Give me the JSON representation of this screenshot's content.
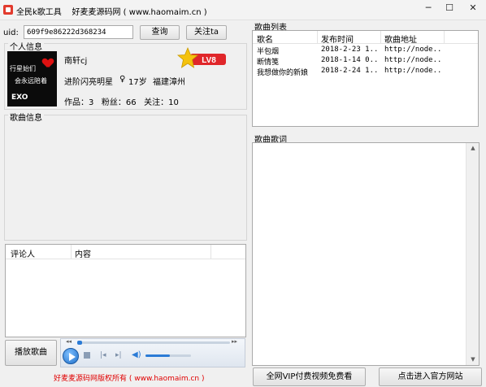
{
  "window": {
    "title": "全民k歌工具    好麦麦源码网 ( www.haomaim.cn )",
    "minimize": "─",
    "maximize": "☐",
    "close": "✕"
  },
  "top": {
    "uid_label": "uid:",
    "uid_value": "609f9e86222d368234",
    "query_button": "查询",
    "follow_button": "关注ta"
  },
  "profile": {
    "section_title": "个人信息",
    "name": "南轩cj",
    "level_badge": "LV8",
    "title_line": "进阶闪亮明星",
    "gender_icon": "♀",
    "age": "17岁",
    "location": "福建漳州",
    "stats": "作品：3   粉丝：66   关注：10",
    "avatar_text": [
      "行星始们",
      "会永远陪着",
      "EXO"
    ]
  },
  "song_info": {
    "section_title": "歌曲信息"
  },
  "comments": {
    "columns": [
      "评论人",
      "内容"
    ],
    "rows": []
  },
  "player": {
    "play_song_button": "播放歌曲"
  },
  "footer": {
    "copyright": "好麦麦源码网版权所有 ( www.haomaim.cn )"
  },
  "song_list": {
    "section_title": "歌曲列表",
    "columns": [
      "歌名",
      "发布时间",
      "歌曲地址"
    ],
    "rows": [
      [
        "半包烟",
        "2018-2-23 1...",
        "http://node..."
      ],
      [
        "断情笺",
        "2018-1-14 0...",
        "http://node..."
      ],
      [
        "我想做你的新娘",
        "2018-2-24 1...",
        "http://node..."
      ]
    ]
  },
  "lyrics": {
    "section_title": "歌曲歌词"
  },
  "bottom_buttons": {
    "vip_video": "全网VIP付费视频免费看",
    "official_site": "点击进入官方网站"
  },
  "colors": {
    "badge_star": "#f4c20d",
    "badge_ribbon": "#e0262a",
    "footer_text": "#e00000",
    "player_accent": "#2b7bd6"
  }
}
